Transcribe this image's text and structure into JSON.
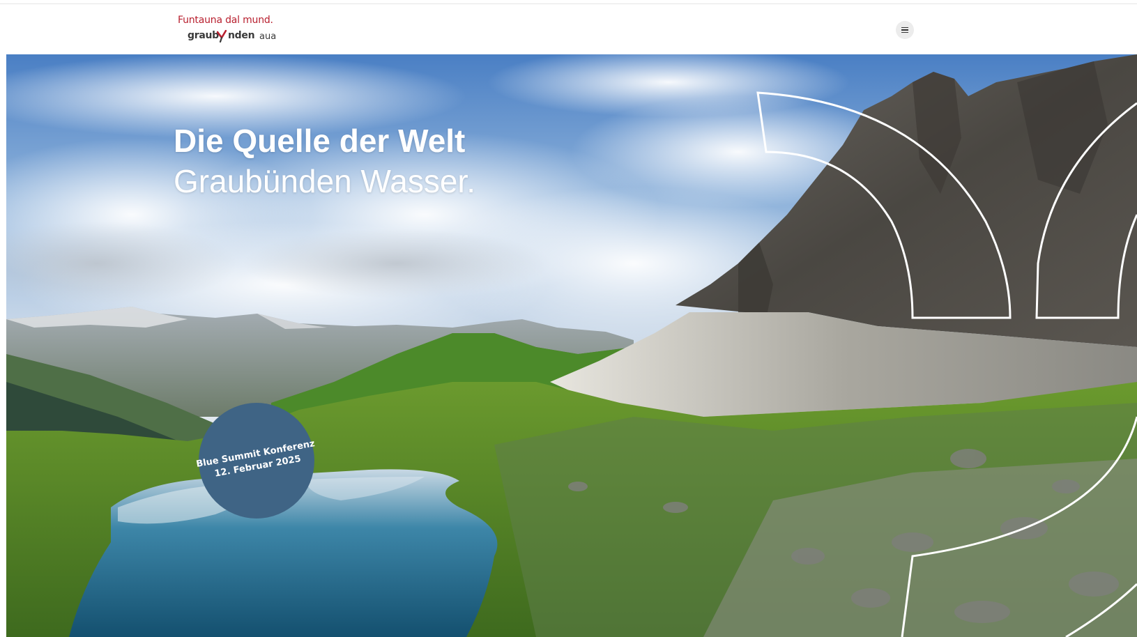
{
  "header": {
    "logo": {
      "tagline": "Funtauna dal mund.",
      "wordmark_start": "graub",
      "wordmark_end": "nden",
      "wordmark_suffix": "aua"
    },
    "menu_icon": "hamburger-menu-icon"
  },
  "hero": {
    "headline_line1": "Die Quelle der Welt",
    "headline_line2": "Graubünden Wasser.",
    "badge": {
      "line1": "Blue Summit Konferenz",
      "line2": "12. Februar 2025"
    }
  },
  "colors": {
    "brand_red": "#b8202f",
    "badge_blue": "#3f6485",
    "text_white": "#ffffff"
  }
}
